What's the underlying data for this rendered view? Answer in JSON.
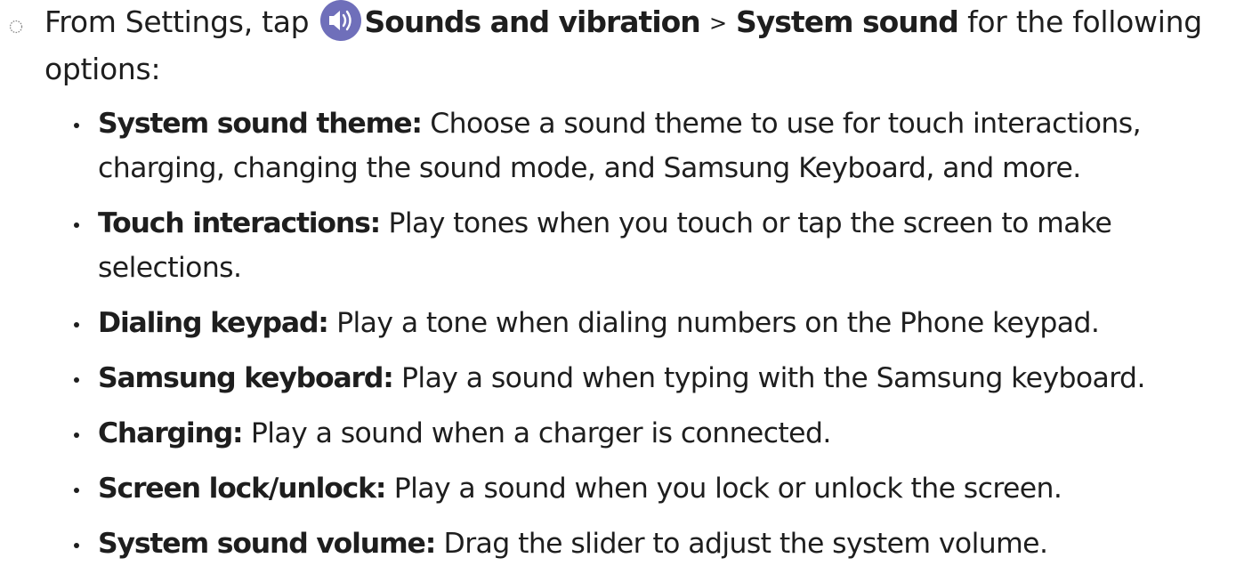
{
  "step": {
    "text_before_icon": "From Settings, tap",
    "icon": "sound-speaker-icon",
    "icon_color": "#6f6fba",
    "menu": "Sounds and vibration",
    "separator": ">",
    "submenu": "System sound",
    "text_after": "for the following options:"
  },
  "options": [
    {
      "term": "System sound theme:",
      "description": "Choose a sound theme to use for touch interactions, charging, changing the sound mode, and Samsung Keyboard, and more."
    },
    {
      "term": "Touch interactions:",
      "description": "Play tones when you touch or tap the screen to make selections."
    },
    {
      "term": "Dialing keypad:",
      "description": "Play a tone when dialing numbers on the Phone keypad."
    },
    {
      "term": "Samsung keyboard:",
      "description": "Play a sound when typing with the Samsung keyboard."
    },
    {
      "term": "Charging:",
      "description": "Play a sound when a charger is connected."
    },
    {
      "term": "Screen lock/unlock:",
      "description": "Play a sound when you lock or unlock the screen."
    },
    {
      "term": "System sound volume:",
      "description": "Drag the slider to adjust the system volume."
    }
  ]
}
